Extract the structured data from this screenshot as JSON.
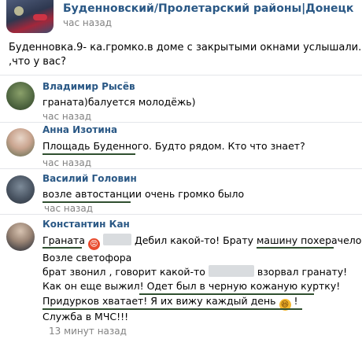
{
  "post": {
    "author": "Буденновский/Пролетарский районы|Донецк",
    "time": "час назад",
    "text_line1": "Буденновка.9- ка.громко.в доме с закрытыми окнами услышали.",
    "text_line2": ",что у вас?"
  },
  "comments": [
    {
      "author": "Владимир Рысёв",
      "text": "граната)балуется молодёжь)",
      "time": "час назад"
    },
    {
      "author": "Анна Изотина",
      "text": "Площадь Буденного. Будто рядом. Кто что знает?",
      "time": "час назад"
    },
    {
      "author": "Василий Головин",
      "text": "возле автостанции очень громко было",
      "time": "час назад"
    },
    {
      "author": "Константин Кан",
      "line1_a": "Граната",
      "line1_b": "Дебил какой-то! Брату машину похерачело",
      "line2": "Возле светофора",
      "line3_a": "брат звонил , говорит какой-то",
      "line3_b": "взорвал гранату!",
      "line4": "Как он еще выжил! Одет был в черную кожаную куртку!",
      "line5_a": "Придурков хватает! Я их вижу каждый день",
      "line5_b": "!",
      "line6": "Служба в МЧС!!!",
      "time": "13 минут назад"
    }
  ],
  "icons": {
    "angry": "angry-face-emoji",
    "laugh": "laughing-face-emoji"
  },
  "colors": {
    "author_link": "#2a5885",
    "muted": "#828282",
    "underline": "#2f4f2f"
  }
}
